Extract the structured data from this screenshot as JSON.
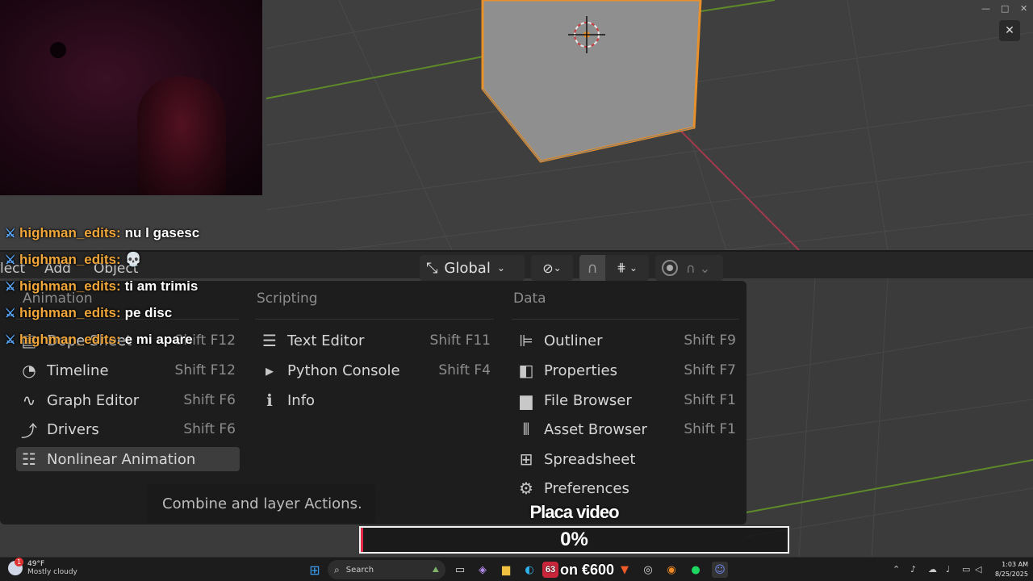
{
  "window": {
    "minimize_glyph": "—",
    "maximize_glyph": "□",
    "close_glyph": "✕"
  },
  "overlay_close_glyph": "✕",
  "header": {
    "menus": [
      "lect",
      "Add",
      "Object"
    ],
    "orientation_value": "Global",
    "orientation_icon": "transform-orientation-icon",
    "pivot_icon": "pivot-point-icon",
    "snap_icon": "magnet-icon",
    "snap_target_icon": "snap-increment-icon",
    "proportional_icon": "proportional-edit-icon",
    "falloff_icon": "falloff-curve-icon"
  },
  "editor_menu": {
    "columns": [
      {
        "header": "Animation",
        "items": [
          {
            "icon": "dope-sheet-icon",
            "glyph": "▤",
            "label": "Dope Sheet",
            "shortcut": "Shift F12"
          },
          {
            "icon": "timeline-icon",
            "glyph": "◔",
            "label": "Timeline",
            "shortcut": "Shift F12"
          },
          {
            "icon": "graph-editor-icon",
            "glyph": "∿",
            "label": "Graph Editor",
            "shortcut": "Shift F6"
          },
          {
            "icon": "drivers-icon",
            "glyph": "⤴",
            "label": "Drivers",
            "shortcut": "Shift F6"
          },
          {
            "icon": "nla-icon",
            "glyph": "☷",
            "label": "Nonlinear Animation",
            "shortcut": ""
          }
        ]
      },
      {
        "header": "Scripting",
        "items": [
          {
            "icon": "text-editor-icon",
            "glyph": "☰",
            "label": "Text Editor",
            "shortcut": "Shift F11"
          },
          {
            "icon": "python-console-icon",
            "glyph": "▸",
            "label": "Python Console",
            "shortcut": "Shift F4"
          },
          {
            "icon": "info-icon",
            "glyph": "ℹ",
            "label": "Info",
            "shortcut": ""
          }
        ]
      },
      {
        "header": "Data",
        "items": [
          {
            "icon": "outliner-icon",
            "glyph": "⊫",
            "label": "Outliner",
            "shortcut": "Shift F9"
          },
          {
            "icon": "properties-icon",
            "glyph": "◧",
            "label": "Properties",
            "shortcut": "Shift F7"
          },
          {
            "icon": "file-browser-icon",
            "glyph": "▆",
            "label": "File Browser",
            "shortcut": "Shift F1"
          },
          {
            "icon": "asset-browser-icon",
            "glyph": "⫴",
            "label": "Asset Browser",
            "shortcut": "Shift F1"
          },
          {
            "icon": "spreadsheet-icon",
            "glyph": "⊞",
            "label": "Spreadsheet",
            "shortcut": ""
          },
          {
            "icon": "preferences-icon",
            "glyph": "⚙",
            "label": "Preferences",
            "shortcut": ""
          }
        ]
      }
    ],
    "tooltip": "Combine and layer Actions."
  },
  "chat": {
    "badge_icon": "sword-badge-icon",
    "badge_glyph": "⚔",
    "messages": [
      {
        "user": "highman_edits:",
        "text": "nu l gasesc"
      },
      {
        "user": "highman_edits:",
        "text": "💀"
      },
      {
        "user": "highman_edits:",
        "text": "ti am trimis"
      },
      {
        "user": "highman_edits:",
        "text": "pe disc"
      },
      {
        "user": "highman_edits:",
        "text": "e mi apare"
      }
    ]
  },
  "goal": {
    "title": "Placa video",
    "percent_label": "0%",
    "progress": 0.0,
    "fill_color": "#e02a48"
  },
  "taskbar": {
    "weather_temp": "49°F",
    "weather_desc": "Mostly cloudy",
    "search_placeholder": "Search",
    "overlay_badge_glyph": "63",
    "overlay_text": "on €600",
    "clock_time": "1:03 AM",
    "clock_date": "8/25/2025",
    "icons": [
      "windows-start-icon",
      "task-view-icon",
      "copilot-icon",
      "file-explorer-icon",
      "edge-icon",
      "brave-icon",
      "obs-icon",
      "blender-icon",
      "spotify-icon",
      "discord-icon"
    ]
  }
}
